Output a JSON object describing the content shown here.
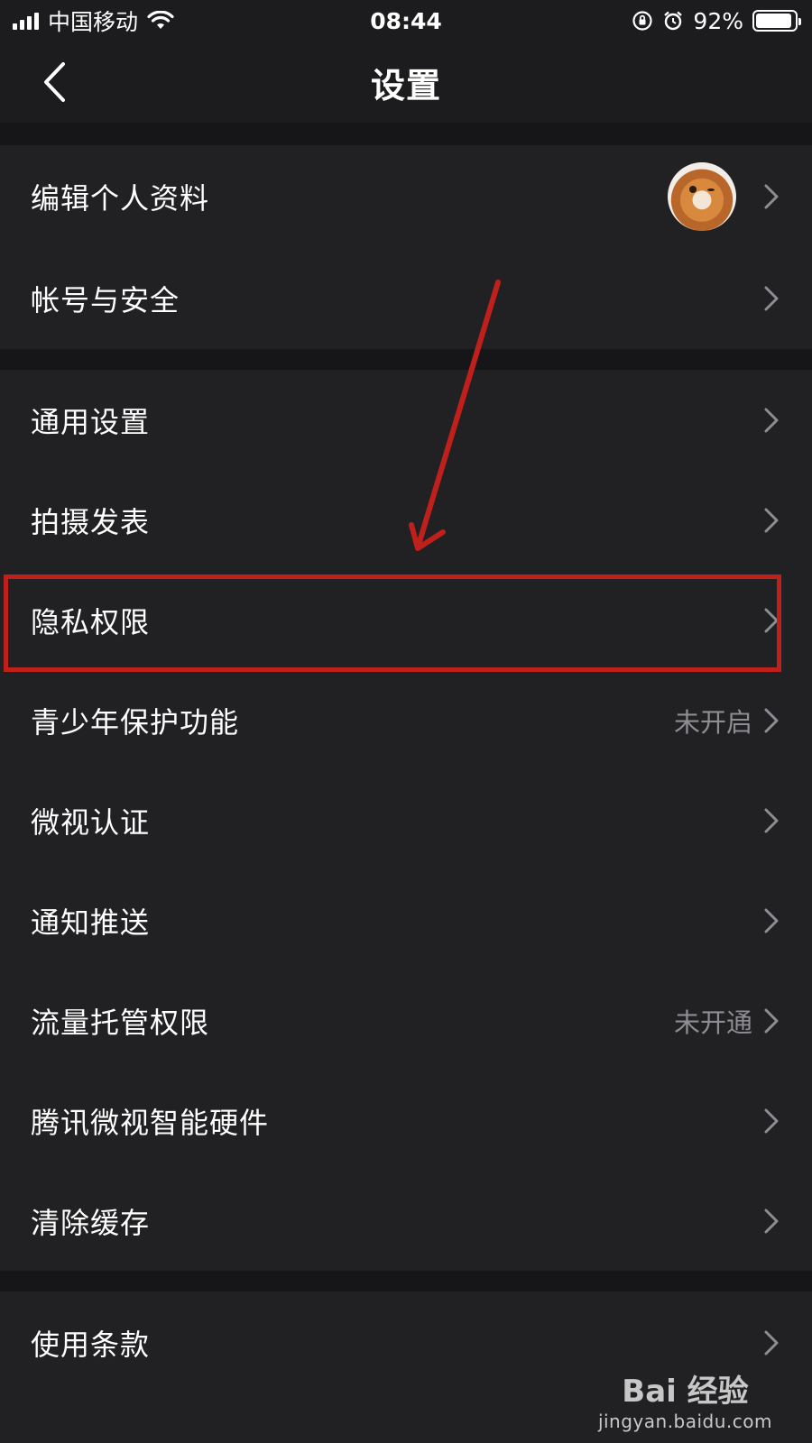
{
  "status_bar": {
    "carrier": "中国移动",
    "time": "08:44",
    "battery_percent": "92%",
    "battery_level": 0.92,
    "icons": [
      "signal-icon",
      "wifi-icon",
      "rotation-lock-icon",
      "alarm-icon",
      "battery-icon"
    ]
  },
  "nav": {
    "title": "设置",
    "back_icon": "chevron-left-icon"
  },
  "groups": [
    {
      "rows": [
        {
          "label": "编辑个人资料",
          "value": "",
          "has_avatar": true
        },
        {
          "label": "帐号与安全",
          "value": ""
        }
      ]
    },
    {
      "rows": [
        {
          "label": "通用设置",
          "value": ""
        },
        {
          "label": "拍摄发表",
          "value": ""
        },
        {
          "label": "隐私权限",
          "value": "",
          "highlighted": true
        },
        {
          "label": "青少年保护功能",
          "value": "未开启"
        },
        {
          "label": "微视认证",
          "value": ""
        },
        {
          "label": "通知推送",
          "value": ""
        },
        {
          "label": "流量托管权限",
          "value": "未开通"
        },
        {
          "label": "腾讯微视智能硬件",
          "value": ""
        },
        {
          "label": "清除缓存",
          "value": ""
        }
      ]
    },
    {
      "rows": [
        {
          "label": "使用条款",
          "value": ""
        }
      ]
    }
  ],
  "annotation": {
    "arrow_color": "#c0201b",
    "highlight_color": "#c0201b"
  },
  "watermark": {
    "logo": "Bai 经验",
    "url": "jingyan.baidu.com"
  },
  "colors": {
    "background": "#161618",
    "row_background": "#212123",
    "text": "#ffffff",
    "secondary_text": "#8d8d92"
  }
}
